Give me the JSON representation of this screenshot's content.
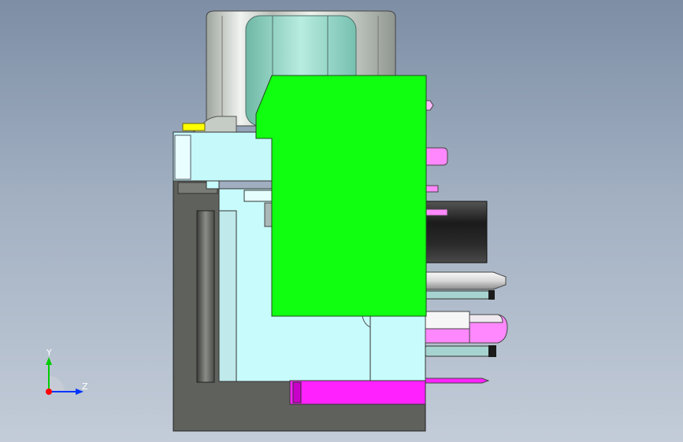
{
  "viewport": {
    "background_top": "#7d8ea5",
    "background_bottom": "#c3ccd8"
  },
  "model": {
    "colors": {
      "green_block": "#10ff10",
      "housing": "#c8fbfb",
      "dark_shell": "#5d5f5b",
      "magenta": "#ff22ff",
      "pink": "#ff88ff",
      "cylinder_dark": "#2b2b2b",
      "knob": "#d6dcd6",
      "knob_inner": "#8acdbd",
      "yellow_tab": "#ffff00",
      "pin_teal": "#6fb7b1"
    }
  },
  "triad": {
    "y_label": "Y",
    "z_label": "Z",
    "y_color": "#00cc00",
    "z_color": "#0033ff",
    "origin_color": "#ff0000"
  }
}
